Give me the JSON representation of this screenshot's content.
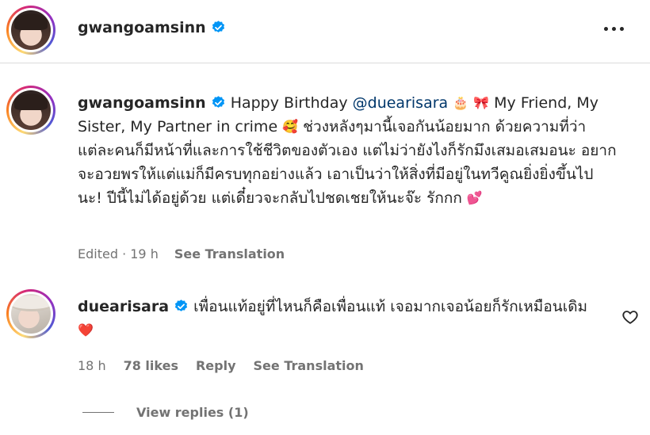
{
  "post": {
    "author": "gwangoamsinn",
    "more_icon": "more-horizontal-icon"
  },
  "caption": {
    "username": "gwangoamsinn",
    "text_1": " Happy Birthday ",
    "mention": "@duearisara",
    "emoji_1": "🎂",
    "emoji_2": "🎀",
    "text_2": " My Friend, My Sister, My Partner in crime ",
    "emoji_3": "🥰",
    "text_3": " ช่วงหลังๆมานี้เจอกันน้อยมาก ด้วยความที่ว่าแต่ละคนก็มีหน้าที่และการใช้ชีวิตของตัวเอง แต่ไม่ว่ายังไงก็รักมึงเสมอเสมอนะ อยากจะอวยพรให้แต่แม่ก็มีครบทุกอย่างแล้ว เอาเป็นว่าให้สิ่งที่มีอยู่ในทวีคูณยิ่งยิ่งขึ้นไปนะ! ปีนี้ไม่ได้อยู่ด้วย แต่เดี๋ยวจะกลับไปชดเชยให้นะจ๊ะ รักกก ",
    "emoji_4": "💕",
    "edited": "Edited · 19 h",
    "see_translation": "See Translation"
  },
  "comment": {
    "username": "duearisara",
    "text": " เพื่อนแท้อยู่ที่ไหนก็คือเพื่อนแท้ เจอมากเจอน้อยก็รักเหมือนเดิม",
    "emoji": "❤️",
    "time": "18 h",
    "likes": "78 likes",
    "reply": "Reply",
    "see_translation": "See Translation",
    "view_replies": "View replies (1)"
  },
  "colors": {
    "verified": "#0095f6",
    "mention": "#00376b",
    "meta": "#737373"
  }
}
